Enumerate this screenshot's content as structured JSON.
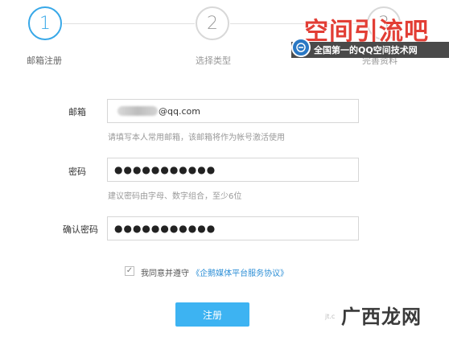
{
  "steps": [
    {
      "number": "1",
      "label": "邮箱注册"
    },
    {
      "number": "2",
      "label": "选择类型"
    },
    {
      "number": "3",
      "label": "完善资料"
    }
  ],
  "form": {
    "email": {
      "label": "邮箱",
      "value": "@qq.com",
      "hint": "请填写本人常用邮箱，该邮箱将作为帐号激活使用"
    },
    "password": {
      "label": "密码",
      "value": "●●●●●●●●●●●",
      "hint": "建议密码由字母、数字组合，至少6位"
    },
    "confirm_password": {
      "label": "确认密码",
      "value": "●●●●●●●●●●●"
    },
    "agreement": {
      "checked": true,
      "checkmark": "✓",
      "text": "我同意并遵守",
      "link": "《企鹅媒体平台服务协议》"
    },
    "submit_label": "注册"
  },
  "watermarks": {
    "top_title": "空间引流吧",
    "top_subtitle": "全国第一的QQ空间技术网",
    "bottom": "广西龙网",
    "bottom_small": "jt.c"
  },
  "colors": {
    "accent": "#38a8e8",
    "button": "#3db3f2",
    "link": "#2b8ed6"
  }
}
